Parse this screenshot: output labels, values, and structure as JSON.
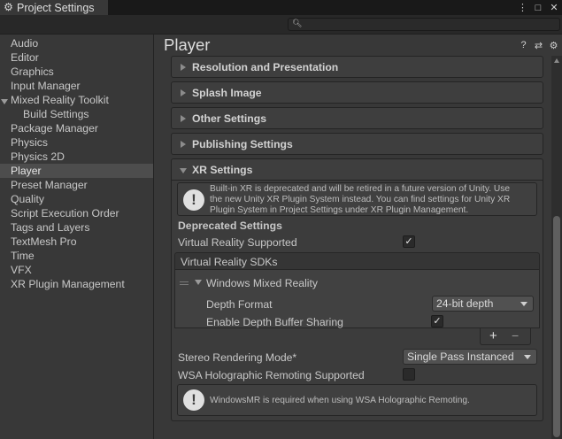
{
  "window": {
    "tab_title": "Project Settings",
    "icons": [
      "gear-icon",
      "more-icon",
      "maximize-icon",
      "close-icon"
    ]
  },
  "search": {
    "placeholder": ""
  },
  "sidebar": {
    "items": [
      {
        "label": "Audio"
      },
      {
        "label": "Editor"
      },
      {
        "label": "Graphics"
      },
      {
        "label": "Input Manager"
      },
      {
        "label": "Mixed Reality Toolkit",
        "expanded": true
      },
      {
        "label": "Build Settings",
        "child": true
      },
      {
        "label": "Package Manager"
      },
      {
        "label": "Physics"
      },
      {
        "label": "Physics 2D"
      },
      {
        "label": "Player",
        "selected": true
      },
      {
        "label": "Preset Manager"
      },
      {
        "label": "Quality"
      },
      {
        "label": "Script Execution Order"
      },
      {
        "label": "Tags and Layers"
      },
      {
        "label": "TextMesh Pro"
      },
      {
        "label": "Time"
      },
      {
        "label": "VFX"
      },
      {
        "label": "XR Plugin Management"
      }
    ]
  },
  "main": {
    "title": "Player",
    "header_icons": [
      "help-icon",
      "presets-icon",
      "settings-icon"
    ],
    "sections": [
      {
        "label": "Resolution and Presentation",
        "expanded": false
      },
      {
        "label": "Splash Image",
        "expanded": false
      },
      {
        "label": "Other Settings",
        "expanded": false
      },
      {
        "label": "Publishing Settings",
        "expanded": false
      },
      {
        "label": "XR Settings",
        "expanded": true
      }
    ],
    "xr": {
      "warning_lines": [
        "Built-in XR is deprecated and will be retired in a future version of Unity. Use",
        "the new Unity XR Plugin System instead. You can find settings for Unity XR",
        "Plugin System in Project Settings under XR Plugin Management."
      ],
      "deprecated_heading": "Deprecated Settings",
      "vr_supported_label": "Virtual Reality Supported",
      "vr_supported": true,
      "sdk_header": "Virtual Reality SDKs",
      "sdk_name": "Windows Mixed Reality",
      "depth_format_label": "Depth Format",
      "depth_format_value": "24-bit depth",
      "depth_sharing_label": "Enable Depth Buffer Sharing",
      "depth_sharing": true,
      "add_symbol": "+",
      "remove_symbol": "−",
      "stereo_label": "Stereo Rendering Mode*",
      "stereo_value": "Single Pass Instanced",
      "remoting_label": "WSA Holographic Remoting Supported",
      "remoting": false,
      "remoting_note": "WindowsMR is required when using WSA Holographic Remoting.",
      "check_mark": "✓"
    }
  }
}
